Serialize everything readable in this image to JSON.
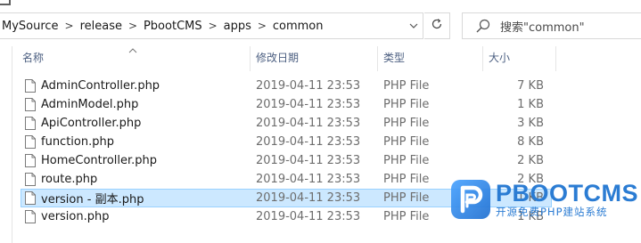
{
  "address_bar": {
    "breadcrumbs": [
      "MySource",
      "release",
      "PbootCMS",
      "apps",
      "common"
    ],
    "separator": ">"
  },
  "search": {
    "placeholder": "搜索\"common\""
  },
  "columns": {
    "name": "名称",
    "date": "修改日期",
    "type": "类型",
    "size": "大小"
  },
  "files": [
    {
      "name": "AdminController.php",
      "date": "2019-04-11 23:53",
      "type": "PHP File",
      "size": "7 KB",
      "selected": false
    },
    {
      "name": "AdminModel.php",
      "date": "2019-04-11 23:53",
      "type": "PHP File",
      "size": "1 KB",
      "selected": false
    },
    {
      "name": "ApiController.php",
      "date": "2019-04-11 23:53",
      "type": "PHP File",
      "size": "3 KB",
      "selected": false
    },
    {
      "name": "function.php",
      "date": "2019-04-11 23:53",
      "type": "PHP File",
      "size": "8 KB",
      "selected": false
    },
    {
      "name": "HomeController.php",
      "date": "2019-04-11 23:53",
      "type": "PHP File",
      "size": "2 KB",
      "selected": false
    },
    {
      "name": "route.php",
      "date": "2019-04-11 23:53",
      "type": "PHP File",
      "size": "2 KB",
      "selected": false
    },
    {
      "name": "version - 副本.php",
      "date": "2019-04-11 23:53",
      "type": "PHP File",
      "size": "1 KB",
      "selected": true
    },
    {
      "name": "version.php",
      "date": "2019-04-11 23:53",
      "type": "PHP File",
      "size": "1 KB",
      "selected": false
    }
  ],
  "watermark": {
    "title": "PBOOTCMS",
    "subtitle": "开源免费PHP建站系统",
    "color": "#2b7cd3"
  },
  "icons": {
    "file": "document-icon",
    "search": "search-icon",
    "refresh": "refresh-icon",
    "dropdown": "chevron-down-icon",
    "sort": "sort-up-icon"
  },
  "colors": {
    "selection_bg": "#cce8ff",
    "selection_border": "#99d1ff",
    "header_text": "#4d6082"
  }
}
